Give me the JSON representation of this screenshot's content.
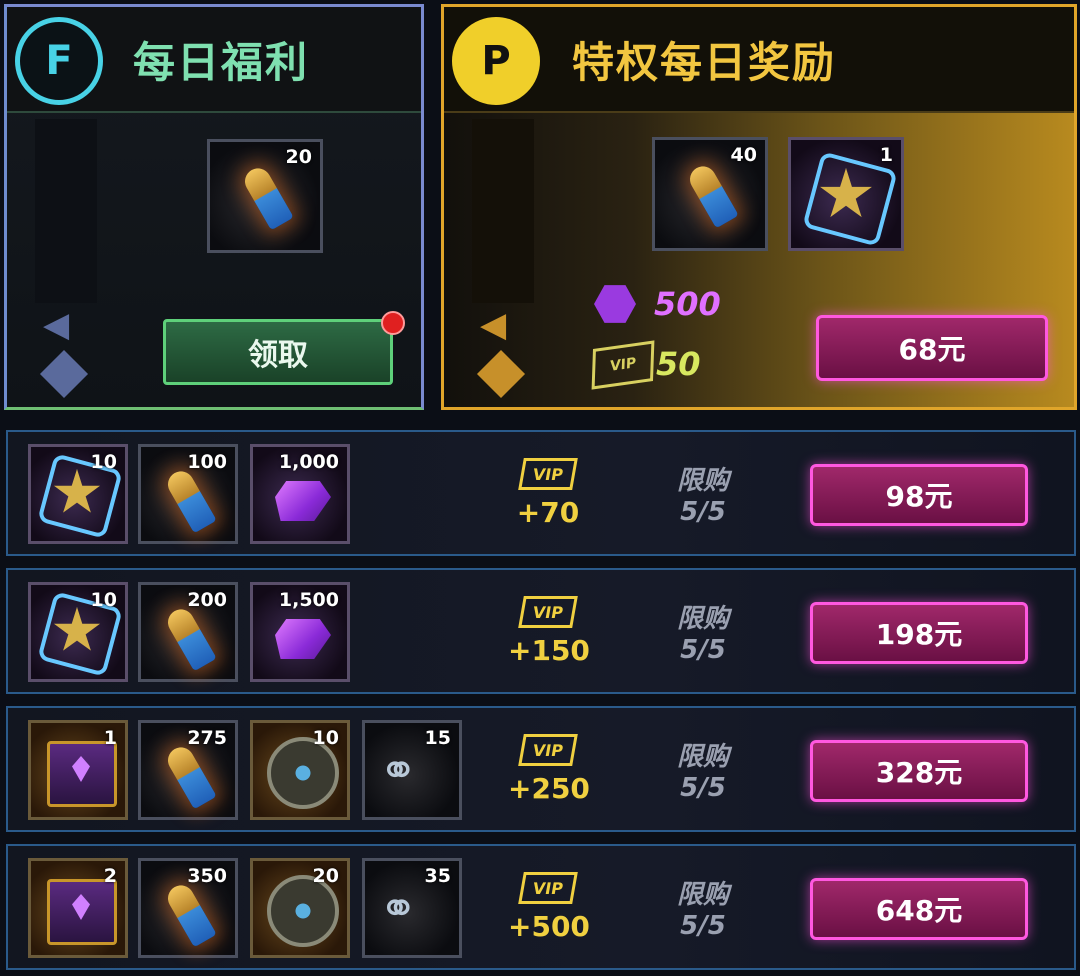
{
  "free_panel": {
    "badge_letter": "F",
    "title": "每日福利",
    "item": {
      "qty": "20"
    },
    "claim_label": "领取"
  },
  "vip_panel": {
    "badge_letter": "P",
    "title": "特权每日奖励",
    "items": [
      {
        "qty": "40"
      },
      {
        "qty": "1"
      }
    ],
    "gems_value": "500",
    "vip_value": "50",
    "price_label": "68元"
  },
  "vip_icon_text": "VIP",
  "packs": [
    {
      "items": [
        {
          "qty": "10"
        },
        {
          "qty": "100"
        },
        {
          "qty": "1,000"
        }
      ],
      "vip_bonus": "+70",
      "limit_label": "限购",
      "limit_value": "5/5",
      "price": "98元"
    },
    {
      "items": [
        {
          "qty": "10"
        },
        {
          "qty": "200"
        },
        {
          "qty": "1,500"
        }
      ],
      "vip_bonus": "+150",
      "limit_label": "限购",
      "limit_value": "5/5",
      "price": "198元"
    },
    {
      "items": [
        {
          "qty": "1"
        },
        {
          "qty": "275"
        },
        {
          "qty": "10"
        },
        {
          "qty": "15"
        }
      ],
      "vip_bonus": "+250",
      "limit_label": "限购",
      "limit_value": "5/5",
      "price": "328元"
    },
    {
      "items": [
        {
          "qty": "2"
        },
        {
          "qty": "350"
        },
        {
          "qty": "20"
        },
        {
          "qty": "35"
        }
      ],
      "vip_bonus": "+500",
      "limit_label": "限购",
      "limit_value": "5/5",
      "price": "648元"
    }
  ],
  "colors": {
    "free_accent": "#7fe0b0",
    "vip_accent": "#f2c640",
    "price_button": "#ff58e0",
    "vip_bonus": "#f0d040"
  },
  "icons": [
    "bullet-icon",
    "police-badge-icon",
    "purple-gem-icon",
    "treasure-chest-icon",
    "fan-token-icon",
    "handcuffs-icon",
    "arrow-left-icon",
    "info-icon"
  ]
}
